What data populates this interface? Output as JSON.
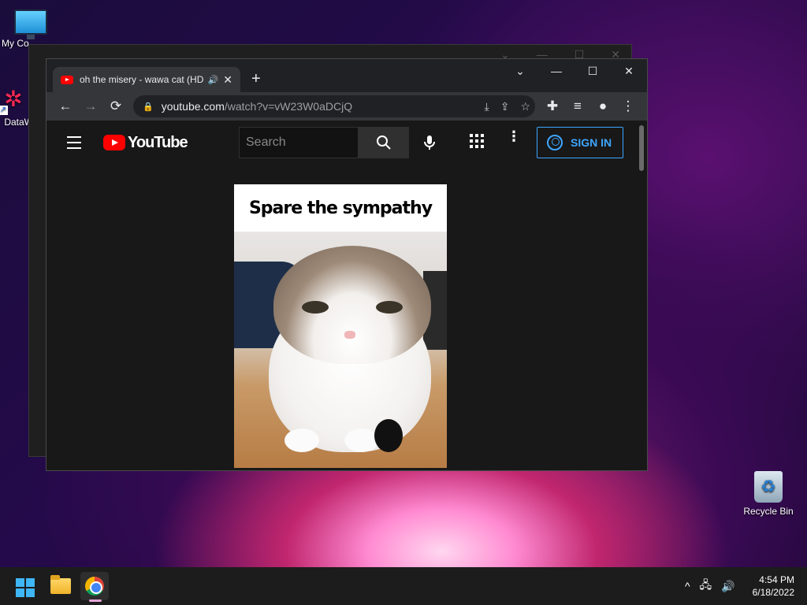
{
  "desktop": {
    "icons": [
      {
        "label": "My Co",
        "icon": "monitor-icon"
      },
      {
        "label": "DataW",
        "icon": "datawrapper-icon"
      },
      {
        "label": "Recycle Bin",
        "icon": "recycle-bin-icon"
      }
    ]
  },
  "browser": {
    "tab": {
      "title": "oh the misery - wawa cat (HD",
      "audio_icon": "speaker-icon",
      "close": "✕"
    },
    "new_tab": "+",
    "window_controls": {
      "dropdown": "⌄",
      "minimize": "—",
      "maximize": "☐",
      "close": "✕"
    },
    "toolbar": {
      "back": "←",
      "forward": "→",
      "reload": "⟳",
      "url_host": "youtube.com",
      "url_path": "/watch?v=vW23W0aDCjQ",
      "install": "⤓",
      "share": "⇪",
      "bookmark": "☆",
      "extensions": "✚",
      "media": "≡",
      "profile": "●",
      "menu": "⋮"
    }
  },
  "youtube": {
    "logo_text": "YouTube",
    "search": {
      "placeholder": "Search"
    },
    "sign_in_label": "SIGN IN",
    "more": "⋮",
    "mic": "🎤",
    "video": {
      "caption": "Spare the sympathy"
    }
  },
  "taskbar": {
    "apps": [
      {
        "name": "Start",
        "icon": "windows-icon"
      },
      {
        "name": "File Explorer",
        "icon": "folder-icon"
      },
      {
        "name": "Google Chrome",
        "icon": "chrome-icon"
      }
    ],
    "tray": {
      "chevron": "^",
      "network": "🖧",
      "volume": "🔊",
      "time": "4:54 PM",
      "date": "6/18/2022"
    }
  },
  "colors": {
    "accent": "#3ea6ff",
    "youtube_red": "#ff0000",
    "chrome_bg": "#202124"
  }
}
